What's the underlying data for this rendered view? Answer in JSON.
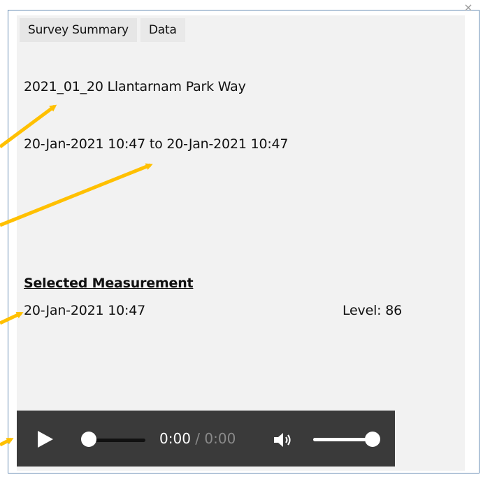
{
  "window": {
    "close_glyph": "×"
  },
  "tabs": [
    {
      "label": "Survey Summary"
    },
    {
      "label": "Data"
    }
  ],
  "survey": {
    "name": "2021_01_20 Llantarnam Park Way",
    "date_range": "20-Jan-2021 10:47 to 20-Jan-2021 10:47"
  },
  "selected_measurement": {
    "heading": "Selected Measurement",
    "datetime": "20-Jan-2021 10:47",
    "level_text": "Level: 86"
  },
  "player": {
    "current_time": "0:00",
    "separator": "/",
    "duration": "0:00",
    "seek_fraction": 0.0,
    "volume_fraction": 1.0,
    "play_icon": "play-icon",
    "volume_icon": "volume-icon"
  },
  "colors": {
    "arrow": "#FFC000",
    "player_bg": "#3a3a3a",
    "panel_bg": "#f2f2f2",
    "frame_border": "#6b8fb5"
  }
}
